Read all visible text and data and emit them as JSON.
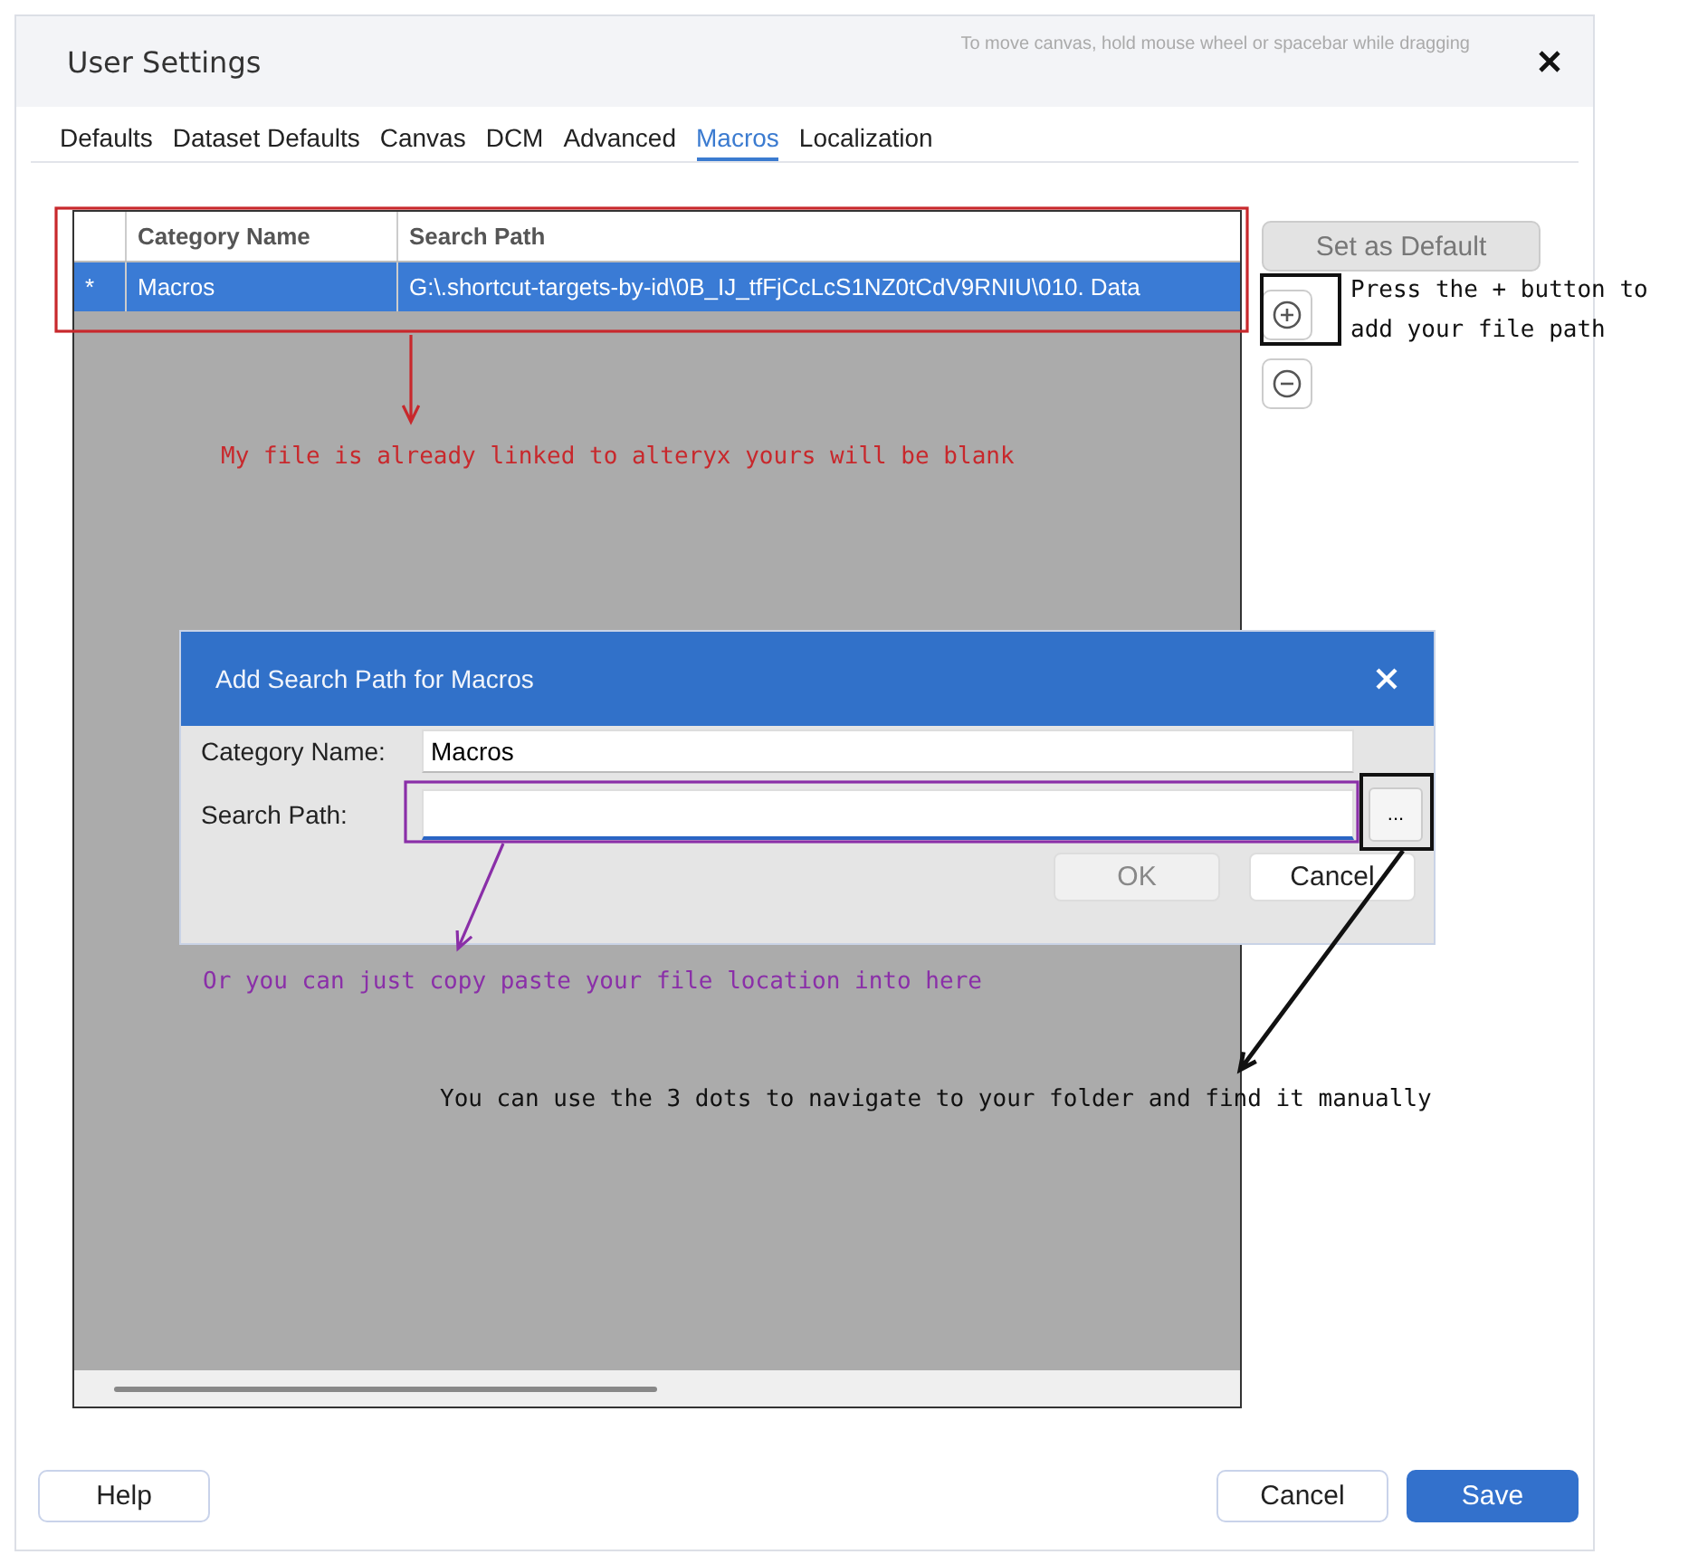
{
  "window": {
    "title": "User Settings",
    "hint": "To move canvas, hold mouse wheel or spacebar while dragging"
  },
  "tabs": [
    {
      "label": "Defaults",
      "selected": false
    },
    {
      "label": "Dataset Defaults",
      "selected": false
    },
    {
      "label": "Canvas",
      "selected": false
    },
    {
      "label": "DCM",
      "selected": false
    },
    {
      "label": "Advanced",
      "selected": false
    },
    {
      "label": "Macros",
      "selected": true
    },
    {
      "label": "Localization",
      "selected": false
    }
  ],
  "table": {
    "columns": [
      "Category Name",
      "Search Path"
    ],
    "rows": [
      {
        "marker": "*",
        "category": "Macros",
        "path": "G:\\.shortcut-targets-by-id\\0B_IJ_tfFjCcLcS1NZ0tCdV9RNIU\\010. Data",
        "selected": true
      }
    ]
  },
  "side_buttons": {
    "set_default": {
      "label": "Set as Default",
      "disabled": true
    }
  },
  "dialog": {
    "title": "Add Search Path for Macros",
    "fields": [
      {
        "label": "Category Name:",
        "value": "Macros",
        "focused": false
      },
      {
        "label": "Search Path:",
        "focused": true
      }
    ],
    "browse": "...",
    "buttons": [
      {
        "label": "OK",
        "disabled": true
      },
      {
        "label": "Cancel",
        "disabled": false
      }
    ]
  },
  "annotations": [
    {
      "text": "My file is already linked to alteryx yours will be blank",
      "color": "#c8282c"
    },
    {
      "text": "Press the + button to add your file path",
      "color": "#111111"
    },
    {
      "text": "Or you can just copy paste your file location into here",
      "color": "#8a2fa8"
    },
    {
      "text": "You can use the 3 dots to navigate to your folder and find it manually",
      "color": "#111111"
    }
  ],
  "footer": [
    {
      "label": "Help",
      "kind": "default"
    },
    {
      "label": "Cancel",
      "kind": "default"
    },
    {
      "label": "Save",
      "kind": "primary"
    }
  ]
}
